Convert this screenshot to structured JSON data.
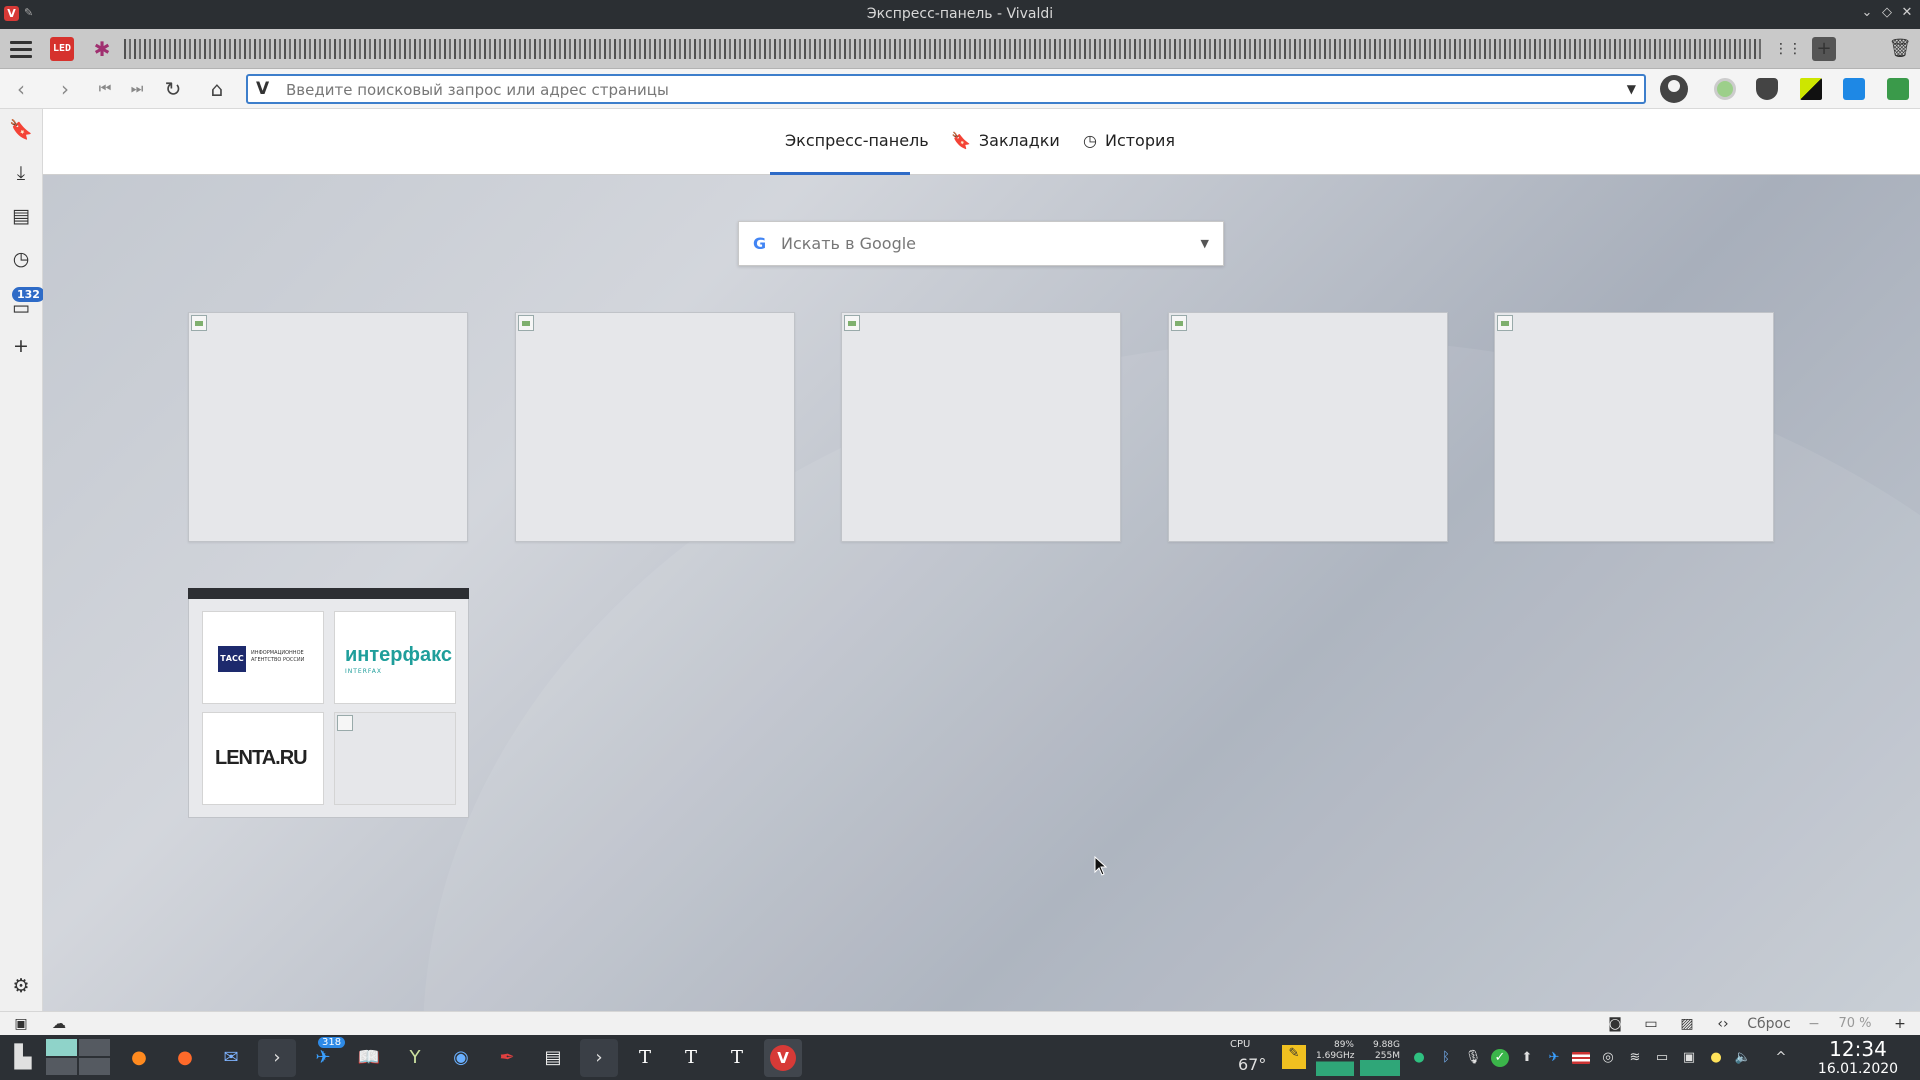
{
  "window": {
    "title": "Экспресс-панель - Vivaldi",
    "app_logo": "V"
  },
  "tabbar": {
    "led_label": "LED",
    "spark_icon": "✱"
  },
  "address_bar": {
    "placeholder": "Введите поисковый запрос или адрес страницы",
    "engine_icon": "V"
  },
  "speed_dial": {
    "tabs": [
      {
        "label": "Экспресс-панель"
      },
      {
        "label": "Закладки"
      },
      {
        "label": "История"
      }
    ],
    "search": {
      "placeholder": "Искать в Google",
      "engine_letter": "G"
    },
    "folder": {
      "items": [
        {
          "name": "ТАСС",
          "logo": "ТАСС",
          "subtitle": "ИНФОРМАЦИОННОЕ АГЕНТСТВО РОССИИ"
        },
        {
          "name": "Интерфакс",
          "logo": "интерфакс",
          "subtitle": "INTERFAX"
        },
        {
          "name": "Lenta.ru",
          "logo": "LENTA.RU"
        }
      ]
    }
  },
  "left_panel": {
    "notes_badge": "132"
  },
  "statusbar": {
    "reset_label": "Сброс",
    "zoom": "70 %"
  },
  "taskbar": {
    "telegram_badge": "318",
    "cpu_label": "CPU",
    "temperature": "67°",
    "cpu_percent": "89%",
    "cpu_freq": "1.69GHz",
    "mem_total": "9.88G",
    "mem_used": "255M",
    "clock_time": "12:34",
    "clock_date": "16.01.2020"
  },
  "colors": {
    "accent": "#2e6bc7",
    "vivaldi_red": "#d73a37",
    "taskbar": "#2c3035"
  }
}
